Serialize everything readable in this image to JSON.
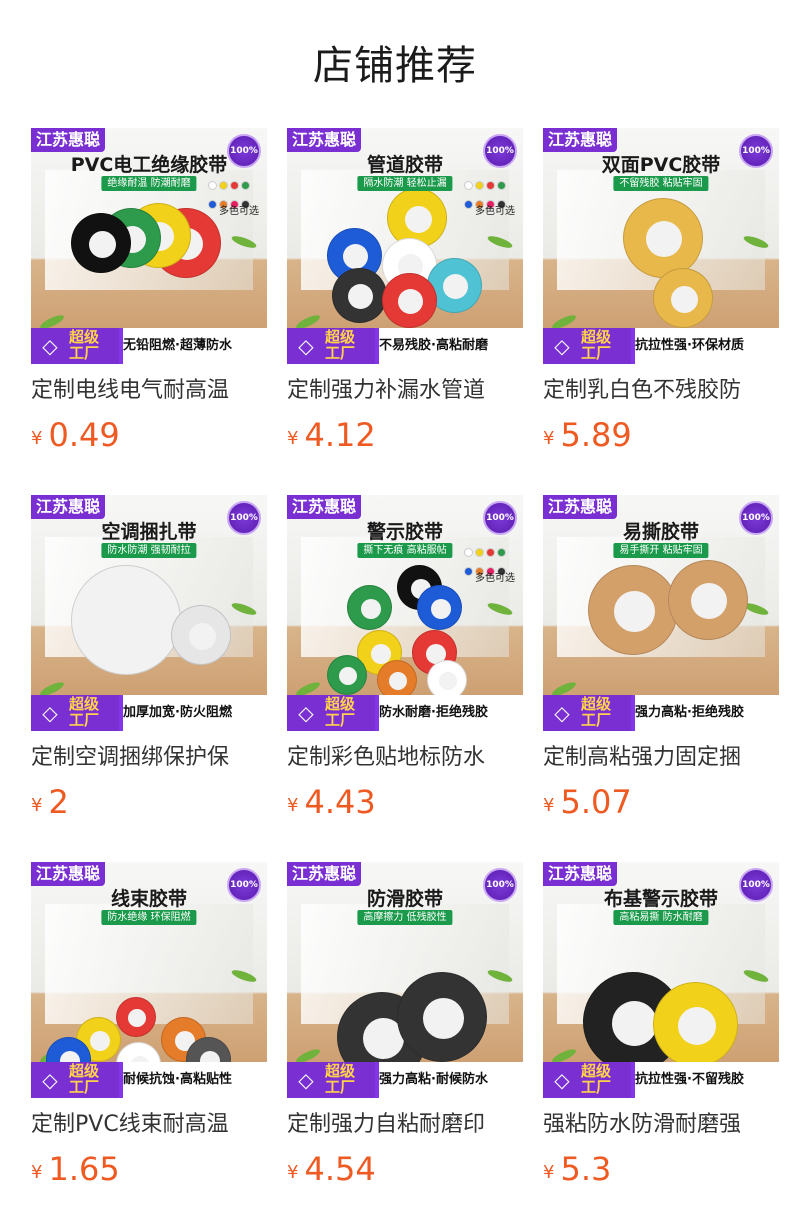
{
  "header": {
    "title": "店铺推荐"
  },
  "common": {
    "brand": "江苏惠聪",
    "badge": "100%",
    "super_factory": "超级\n工厂",
    "multi_color": "多色可选",
    "currency": "¥"
  },
  "products": [
    {
      "title": "PVC电工绝缘胶带",
      "tagline": "绝缘耐温 防潮耐磨",
      "slogan": "无铅阻燃·超薄防水",
      "name": "定制电线电气耐高温",
      "price": "0.49",
      "multi": true
    },
    {
      "title": "管道胶带",
      "tagline": "隔水防潮 轻松止漏",
      "slogan": "不易残胶·高粘耐磨",
      "name": "定制强力补漏水管道",
      "price": "4.12",
      "multi": true
    },
    {
      "title": "双面PVC胶带",
      "tagline": "不留残胶 粘贴牢固",
      "slogan": "抗拉性强·环保材质",
      "name": "定制乳白色不残胶防",
      "price": "5.89",
      "multi": false
    },
    {
      "title": "空调捆扎带",
      "tagline": "防水防潮 强韧耐拉",
      "slogan": "加厚加宽·防火阻燃",
      "name": "定制空调捆绑保护保",
      "price": "2",
      "multi": false
    },
    {
      "title": "警示胶带",
      "tagline": "撕下无痕 高粘服帖",
      "slogan": "防水耐磨·拒绝残胶",
      "name": "定制彩色贴地标防水",
      "price": "4.43",
      "multi": true
    },
    {
      "title": "易撕胶带",
      "tagline": "易手撕开 粘贴牢固",
      "slogan": "强力高粘·拒绝残胶",
      "name": "定制高粘强力固定捆",
      "price": "5.07",
      "multi": false
    },
    {
      "title": "线束胶带",
      "tagline": "防水绝缘 环保阻燃",
      "slogan": "耐候抗蚀·高粘贴性",
      "name": "定制PVC线束耐高温",
      "price": "1.65",
      "multi": false
    },
    {
      "title": "防滑胶带",
      "tagline": "高摩擦力 低残胶性",
      "slogan": "强力高粘·耐候防水",
      "name": "定制强力自粘耐磨印",
      "price": "4.54",
      "multi": false
    },
    {
      "title": "布基警示胶带",
      "tagline": "高粘易撕 防水耐磨",
      "slogan": "抗拉性强·不留残胶",
      "name": "强粘防水防滑耐磨强",
      "price": "5.3",
      "multi": false
    }
  ],
  "colors": {
    "accent": "#7a2fd3",
    "price": "#ee5a22"
  },
  "color_dots": [
    "#ffffff",
    "#f2d11b",
    "#e53935",
    "#2e9a4b",
    "#1e5bd6",
    "#e57c2a",
    "#e91e63",
    "#333333"
  ]
}
